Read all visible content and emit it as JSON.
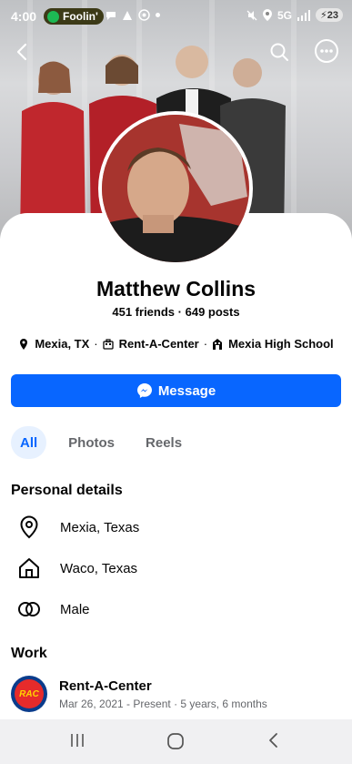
{
  "status_bar": {
    "time": "4:00",
    "music_label": "Foolin'",
    "network": "5G",
    "battery": "23"
  },
  "profile": {
    "name": "Matthew Collins",
    "friends": "451 friends",
    "posts": "649 posts",
    "separator": "·",
    "intro": [
      {
        "icon": "location-pin-icon",
        "text": "Mexia, TX"
      },
      {
        "icon": "briefcase-icon",
        "text": "Rent-A-Center"
      },
      {
        "icon": "school-icon",
        "text": "Mexia High School"
      }
    ]
  },
  "actions": {
    "message_label": "Message"
  },
  "tabs": [
    {
      "label": "All",
      "active": true
    },
    {
      "label": "Photos",
      "active": false
    },
    {
      "label": "Reels",
      "active": false
    }
  ],
  "personal_details": {
    "title": "Personal details",
    "items": [
      {
        "icon": "location-pin-icon",
        "text": "Mexia, Texas"
      },
      {
        "icon": "home-icon",
        "text": "Waco, Texas"
      },
      {
        "icon": "gender-icon",
        "text": "Male"
      }
    ]
  },
  "work": {
    "title": "Work",
    "employer": "Rent-A-Center",
    "logo_text": "RAC",
    "dates": "Mar 26, 2021 - Present · 5 years, 6 months"
  },
  "colors": {
    "accent": "#0866ff",
    "tab_active_bg": "#e7f1ff",
    "muted_text": "#65676b"
  }
}
